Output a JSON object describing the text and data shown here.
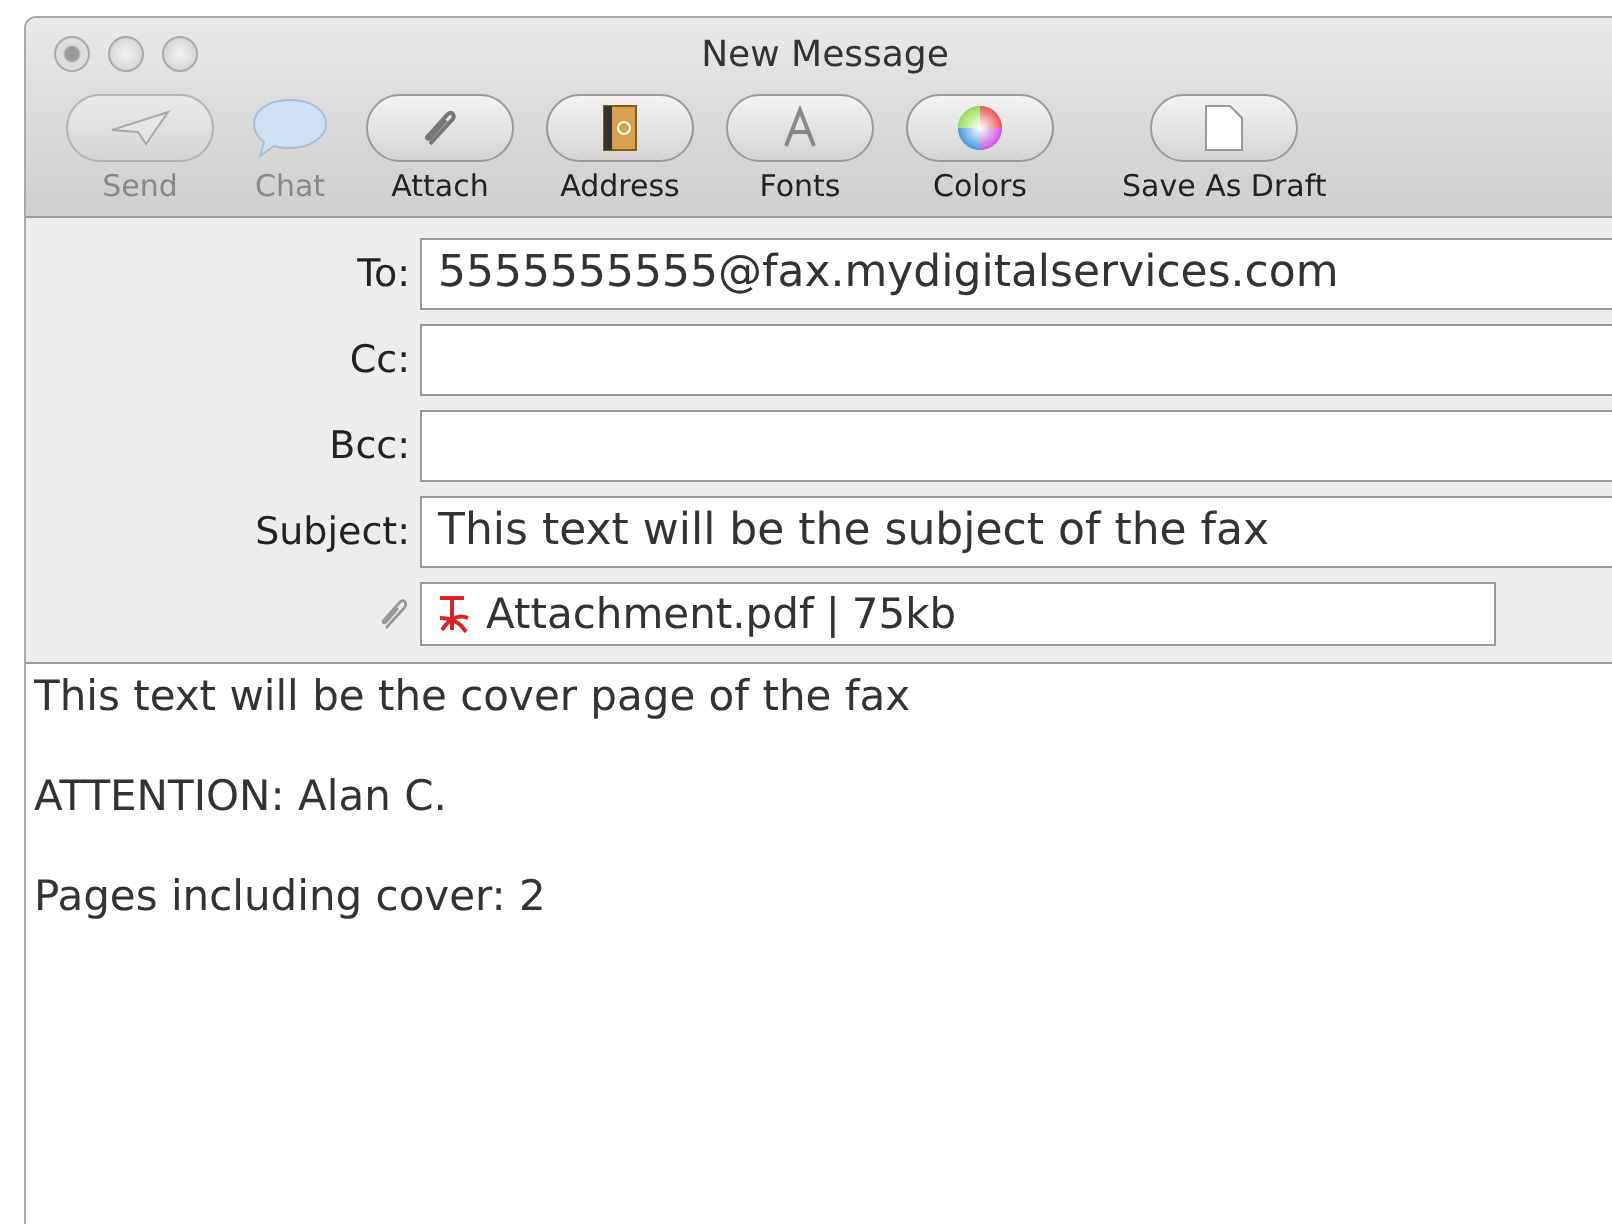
{
  "window": {
    "title": "New Message"
  },
  "toolbar": [
    {
      "kind": "send",
      "label": "Send",
      "disabled": true
    },
    {
      "kind": "chat",
      "label": "Chat",
      "disabled": true
    },
    {
      "kind": "attach",
      "label": "Attach",
      "disabled": false
    },
    {
      "kind": "address",
      "label": "Address",
      "disabled": false
    },
    {
      "kind": "fonts",
      "label": "Fonts",
      "disabled": false
    },
    {
      "kind": "colors",
      "label": "Colors",
      "disabled": false
    },
    {
      "kind": "draft",
      "label": "Save As Draft",
      "disabled": false
    }
  ],
  "fields": [
    {
      "label": "To:",
      "value": "5555555555@fax.mydigitalservices.com"
    },
    {
      "label": "Cc:"
    },
    {
      "label": "Bcc:"
    },
    {
      "label": "Subject:",
      "value": "This text will be the subject of the fax"
    }
  ],
  "attachment": {
    "name": "Attachment.pdf",
    "separator": "|",
    "size": "75kb"
  },
  "body": [
    "This text will be the cover page of the fax",
    "ATTENTION: Alan C.",
    "Pages including cover: 2"
  ]
}
